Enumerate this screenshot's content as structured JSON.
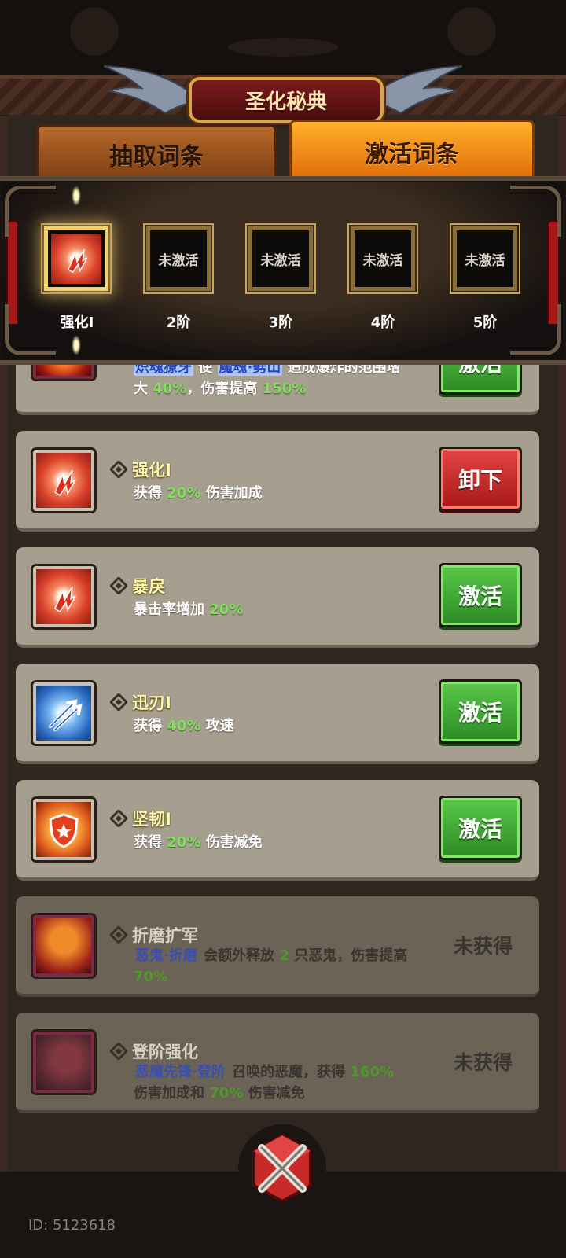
{
  "title": "圣化秘典",
  "tabs": [
    {
      "label": "抽取词条",
      "active": false
    },
    {
      "label": "激活词条",
      "active": true
    }
  ],
  "slots": [
    {
      "content": "",
      "label": "强化I",
      "active": true,
      "icon": "fire-rune-icon"
    },
    {
      "content": "未激活",
      "label": "2阶",
      "active": false
    },
    {
      "content": "未激活",
      "label": "3阶",
      "active": false
    },
    {
      "content": "未激活",
      "label": "4阶",
      "active": false
    },
    {
      "content": "未激活",
      "label": "5阶",
      "active": false
    }
  ],
  "entries": [
    {
      "icon": "demon-beast-icon",
      "title": "",
      "desc_parts": [
        {
          "t": "炽魂獠牙",
          "c": "blue"
        },
        {
          "t": " 使 ",
          "c": ""
        },
        {
          "t": "魔魂·劈山",
          "c": "blue"
        },
        {
          "t": " 造成爆炸的范围增大 ",
          "c": ""
        },
        {
          "t": "40%",
          "c": "green"
        },
        {
          "t": "，伤害提高 ",
          "c": ""
        },
        {
          "t": "150%",
          "c": "green"
        }
      ],
      "button": "激活",
      "button_type": "green"
    },
    {
      "icon": "fire-rune-icon",
      "title": "强化I",
      "desc_parts": [
        {
          "t": "获得 ",
          "c": ""
        },
        {
          "t": "20%",
          "c": "green"
        },
        {
          "t": " 伤害加成",
          "c": ""
        }
      ],
      "button": "卸下",
      "button_type": "red"
    },
    {
      "icon": "fire-rune-icon",
      "title": "暴戾",
      "desc_parts": [
        {
          "t": "暴击率增加 ",
          "c": ""
        },
        {
          "t": "20%",
          "c": "green"
        }
      ],
      "button": "激活",
      "button_type": "green"
    },
    {
      "icon": "arrow-speed-icon",
      "title": "迅刃I",
      "desc_parts": [
        {
          "t": "获得 ",
          "c": ""
        },
        {
          "t": "40%",
          "c": "green"
        },
        {
          "t": " 攻速",
          "c": ""
        }
      ],
      "button": "激活",
      "button_type": "green"
    },
    {
      "icon": "shield-star-icon",
      "title": "坚韧I",
      "desc_parts": [
        {
          "t": "获得 ",
          "c": ""
        },
        {
          "t": "20%",
          "c": "green"
        },
        {
          "t": " 伤害减免",
          "c": ""
        }
      ],
      "button": "激活",
      "button_type": "green"
    },
    {
      "icon": "fire-demon-icon",
      "title": "折磨扩军",
      "desc_parts": [
        {
          "t": "恶鬼·折磨",
          "c": "blue"
        },
        {
          "t": " 会额外释放 ",
          "c": ""
        },
        {
          "t": "2",
          "c": "green"
        },
        {
          "t": " 只恶鬼，伤害提高 ",
          "c": ""
        },
        {
          "t": "70%",
          "c": "green"
        }
      ],
      "status": "未获得"
    },
    {
      "icon": "dark-demon-icon",
      "title": "登阶强化",
      "desc_parts": [
        {
          "t": "恶魔先锋·登阶",
          "c": "blue"
        },
        {
          "t": " 召唤的恶魔，获得 ",
          "c": ""
        },
        {
          "t": "160%",
          "c": "green"
        },
        {
          "t": " 伤害加成和 ",
          "c": ""
        },
        {
          "t": "70%",
          "c": "green"
        },
        {
          "t": " 伤害减免",
          "c": ""
        }
      ],
      "status": "未获得"
    }
  ],
  "footer": {
    "id_text": "ID: 5123618",
    "close_icon": "crossed-swords-close-icon"
  },
  "colors": {
    "accent_gold": "#f2d074",
    "green_button": "#2d8a24",
    "red_button": "#a51818",
    "value_green": "#7fe05a",
    "skill_blue": "#2a46b8"
  }
}
